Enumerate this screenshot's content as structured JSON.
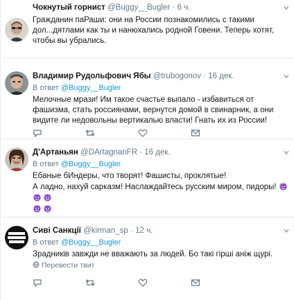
{
  "tweets": [
    {
      "name": "Чокнутый горнист",
      "handle": "@Buggy__Bugler",
      "dot": "·",
      "time": "6 ч.",
      "text": "Гражданин паРаши: они на России познакомились с такими дол...дятлами как ты и нанюхались родной Говени. Теперь хотят, чтобы вы убрались."
    },
    {
      "name": "Владимир Рудольфович Ябы",
      "handle": "@trubogonov",
      "dot": "·",
      "time": "16 дек.",
      "reply_prefix": "В ответ",
      "reply_to": "@Buggy__Bugler",
      "text": "Мелочные мрази! Им такое счастье выпало - избавиться от фашизма, стать россиянами, вернутся домой в свинарник, а они видите ли недовольны вертикалью власти! Гнать их из России!"
    },
    {
      "name": "Д'Артаньян",
      "handle": "@DArtagnanFR",
      "dot": "·",
      "time": "16 дек.",
      "reply_prefix": "В ответ",
      "reply_to": "@Buggy__Bugler",
      "text_line1": "Ебаные бИндеры, что творят! Фашисты, проклятые!",
      "text_line2": "А ладно, нахуй сарказм! Наслаждайтесь русским миром, пидоры!"
    },
    {
      "name": "Сиві Санкції",
      "handle": "@kirman_sp",
      "dot": "·",
      "time": "12 ч.",
      "reply_prefix": "В ответ",
      "reply_to": "@Buggy__Bugler",
      "text": "Зрадників завжди не вважають за людей. Бо такі гірші аніж щурі.",
      "translate": "Перевести твит"
    }
  ],
  "colors": {
    "link": "#1b95e0",
    "muted": "#657786",
    "border": "#e6ecf0",
    "emoji": "#8a4fc8"
  },
  "icons": [
    "reply-icon",
    "retweet-icon",
    "like-icon",
    "dm-icon",
    "caret-down-icon",
    "globe-icon",
    "devil-emoji-icon"
  ]
}
